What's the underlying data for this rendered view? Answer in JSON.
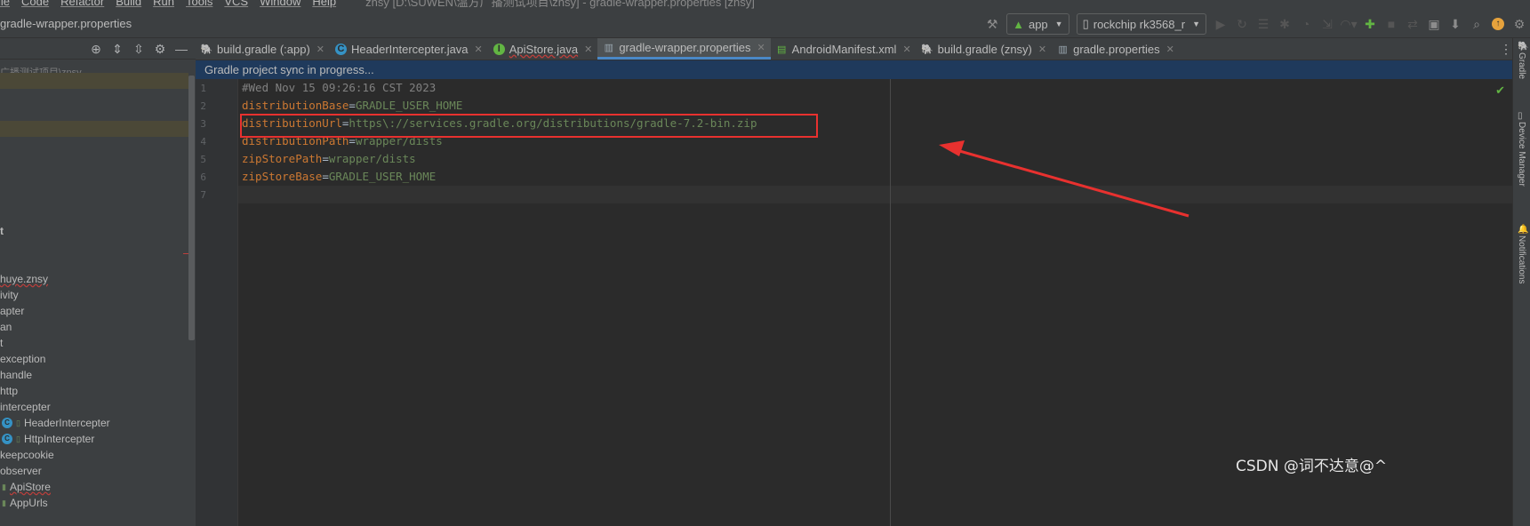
{
  "menu": {
    "items": [
      "ile",
      "Code",
      "Refactor",
      "Build",
      "Run",
      "Tools",
      "VCS",
      "Window",
      "Help"
    ],
    "project_title": "znsy [D:\\SUWEN\\温方广播测试项目\\znsy] - gradle-wrapper.properties [znsy]"
  },
  "navbar": {
    "breadcrumb": "gradle-wrapper.properties",
    "run_config": "app",
    "device": "rockchip rk3568_r"
  },
  "project_panel": {
    "path_text": "广播测试项目\\znsy",
    "items": [
      {
        "label": "t",
        "icon": "none"
      },
      {
        "label": "huye.znsy",
        "icon": "none"
      },
      {
        "label": "ivity",
        "icon": "none"
      },
      {
        "label": "apter",
        "icon": "none"
      },
      {
        "label": "an",
        "icon": "none"
      },
      {
        "label": "t",
        "icon": "none"
      },
      {
        "label": "exception",
        "icon": "none"
      },
      {
        "label": "handle",
        "icon": "none"
      },
      {
        "label": "http",
        "icon": "none"
      },
      {
        "label": "intercepter",
        "icon": "none"
      },
      {
        "label": "HeaderIntercepter",
        "icon": "class-icon"
      },
      {
        "label": "HttpIntercepter",
        "icon": "class-icon"
      },
      {
        "label": "keepcookie",
        "icon": "none"
      },
      {
        "label": "observer",
        "icon": "none"
      },
      {
        "label": "ApiStore",
        "icon": "interface-icon"
      },
      {
        "label": "AppUrls",
        "icon": "interface-icon"
      }
    ]
  },
  "tabs": [
    {
      "label": "build.gradle (:app)",
      "icon": "gradle-icon",
      "active": false
    },
    {
      "label": "HeaderIntercepter.java",
      "icon": "class-icon",
      "active": false
    },
    {
      "label": "ApiStore.java",
      "icon": "interface-icon",
      "active": false
    },
    {
      "label": "gradle-wrapper.properties",
      "icon": "properties-icon",
      "active": true
    },
    {
      "label": "AndroidManifest.xml",
      "icon": "manifest-icon",
      "active": false
    },
    {
      "label": "build.gradle (znsy)",
      "icon": "gradle-icon",
      "active": false
    },
    {
      "label": "gradle.properties",
      "icon": "properties-icon",
      "active": false
    }
  ],
  "banner": {
    "text": "Gradle project sync in progress..."
  },
  "editor": {
    "lines": [
      {
        "num": "1",
        "key": "#Wed Nov 15 09:26:16 CST 2023",
        "type": "comment",
        "value": ""
      },
      {
        "num": "2",
        "key": "distributionBase",
        "type": "prop",
        "value": "GRADLE_USER_HOME"
      },
      {
        "num": "3",
        "key": "distributionUrl",
        "type": "prop",
        "value": "https\\://services.gradle.org/distributions/gradle-7.2-bin.zip"
      },
      {
        "num": "4",
        "key": "distributionPath",
        "type": "prop",
        "value": "wrapper/dists"
      },
      {
        "num": "5",
        "key": "zipStorePath",
        "type": "prop",
        "value": "wrapper/dists"
      },
      {
        "num": "6",
        "key": "zipStoreBase",
        "type": "prop",
        "value": "GRADLE_USER_HOME"
      },
      {
        "num": "7",
        "key": "",
        "type": "empty",
        "value": ""
      }
    ]
  },
  "right_stripe": {
    "labels": [
      "Gradle",
      "Device Manager",
      "Notifications"
    ]
  },
  "watermark": "CSDN @词不达意@^",
  "colors": {
    "annotation_red": "#e8312f",
    "active_tab_underline": "#4a88c7",
    "banner_bg": "#1f3a5c"
  }
}
